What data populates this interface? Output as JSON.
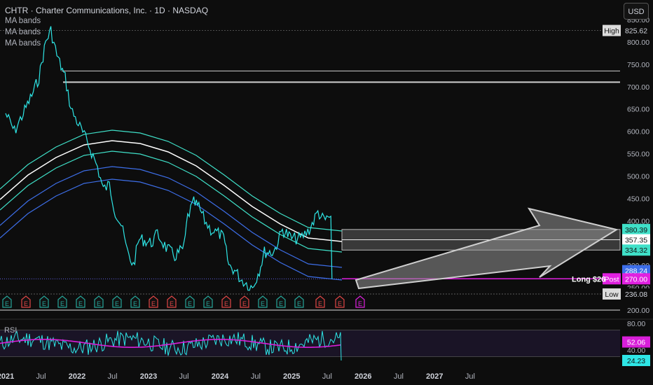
{
  "header": {
    "title": "CHTR · Charter Communications, Inc. · 1D · NASDAQ",
    "indicators": [
      "MA bands",
      "MA bands",
      "MA bands"
    ],
    "currency_button": "USD"
  },
  "rsi_label": "RSI",
  "colors": {
    "background": "#0d0d0d",
    "price": "#2ee6e6",
    "band_outer": "#3fe0c8",
    "band_mid": "#ffffff",
    "band_lower": "#3d6ee8",
    "rsi_line": "#2ee6e6",
    "rsi_ma": "#d91fd9",
    "post_magenta": "#e020e0",
    "earnings_red": "#e04646",
    "earnings_green": "#26a69a"
  },
  "price_axis": {
    "ticks": [
      "850.00",
      "800.00",
      "750.00",
      "700.00",
      "650.00",
      "600.00",
      "550.00",
      "500.00",
      "450.00",
      "400.00",
      "350.00",
      "300.00",
      "250.00",
      "200.00"
    ],
    "labels": [
      {
        "tag": "High",
        "value": "825.62"
      },
      {
        "tag": "",
        "value": "380.39"
      },
      {
        "tag": "",
        "value": "357.35"
      },
      {
        "tag": "",
        "value": "334.32"
      },
      {
        "tag": "",
        "value": "288.24"
      },
      {
        "tag": "Post",
        "value": "270.00"
      },
      {
        "tag": "Low",
        "value": "236.08"
      }
    ]
  },
  "rsi_axis": {
    "ticks": [
      "80.00",
      "40.00"
    ],
    "labels": [
      "52.06",
      "24.23"
    ]
  },
  "time_axis": [
    "2021",
    "Jul",
    "2022",
    "Jul",
    "2023",
    "Jul",
    "2024",
    "Jul",
    "2025",
    "Jul",
    "2026",
    "Jul",
    "2027",
    "Jul"
  ],
  "annotations": {
    "long_label": "Long $26"
  },
  "earnings_markers": [
    "E",
    "E",
    "E",
    "E",
    "E",
    "E",
    "E",
    "E",
    "E",
    "E",
    "E",
    "E",
    "E",
    "E",
    "E",
    "E",
    "E",
    "E",
    "E",
    "E"
  ],
  "earnings_types": [
    "g",
    "r",
    "g",
    "g",
    "g",
    "g",
    "g",
    "g",
    "r",
    "r",
    "g",
    "g",
    "r",
    "r",
    "g",
    "g",
    "g",
    "r",
    "r",
    "p"
  ],
  "chart_data": {
    "type": "line",
    "series": [
      {
        "values": [
          [
            "2021-01-01",
            640
          ],
          [
            "2021-02-15",
            600
          ],
          [
            "2021-04-01",
            640
          ],
          [
            "2021-05-15",
            680
          ],
          [
            "2021-06-20",
            720
          ],
          [
            "2021-07-25",
            800
          ],
          [
            "2021-08-20",
            825.62
          ],
          [
            "2021-09-20",
            770
          ],
          [
            "2021-11-01",
            720
          ],
          [
            "2021-12-01",
            650
          ],
          [
            "2022-01-15",
            610
          ],
          [
            "2022-03-01",
            570
          ],
          [
            "2022-04-15",
            520
          ],
          [
            "2022-05-15",
            470
          ],
          [
            "2022-06-15",
            480
          ],
          [
            "2022-07-15",
            420
          ],
          [
            "2022-08-15",
            390
          ],
          [
            "2022-09-15",
            330
          ],
          [
            "2022-10-15",
            300
          ],
          [
            "2022-11-15",
            360
          ],
          [
            "2023-01-15",
            350
          ],
          [
            "2023-02-15",
            370
          ],
          [
            "2023-04-01",
            340
          ],
          [
            "2023-05-15",
            320
          ],
          [
            "2023-07-01",
            340
          ],
          [
            "2023-07-20",
            410
          ],
          [
            "2023-08-20",
            440
          ],
          [
            "2023-09-15",
            430
          ],
          [
            "2023-10-15",
            400
          ],
          [
            "2023-11-15",
            380
          ],
          [
            "2023-12-31",
            370
          ],
          [
            "2024-01-20",
            360
          ],
          [
            "2024-02-15",
            300
          ],
          [
            "2024-03-15",
            290
          ],
          [
            "2024-04-15",
            270
          ],
          [
            "2024-05-15",
            260
          ],
          [
            "2024-06-15",
            250
          ],
          [
            "2024-07-20",
            290
          ],
          [
            "2024-08-15",
            330
          ],
          [
            "2024-10-01",
            330
          ],
          [
            "2024-11-15",
            380
          ],
          [
            "2025-01-01",
            360
          ],
          [
            "2025-02-15",
            360
          ],
          [
            "2025-04-01",
            380
          ],
          [
            "2025-05-15",
            420
          ],
          [
            "2025-06-15",
            400
          ],
          [
            "2025-07-20",
            410
          ],
          [
            "2025-07-26",
            270
          ]
        ]
      }
    ],
    "horizontal_levels": [
      825.62,
      735,
      710,
      380.39,
      357.35,
      334.32,
      270.0,
      236.08,
      200
    ],
    "rsi": {
      "last": 24.23,
      "ma_last": 52.06
    }
  }
}
